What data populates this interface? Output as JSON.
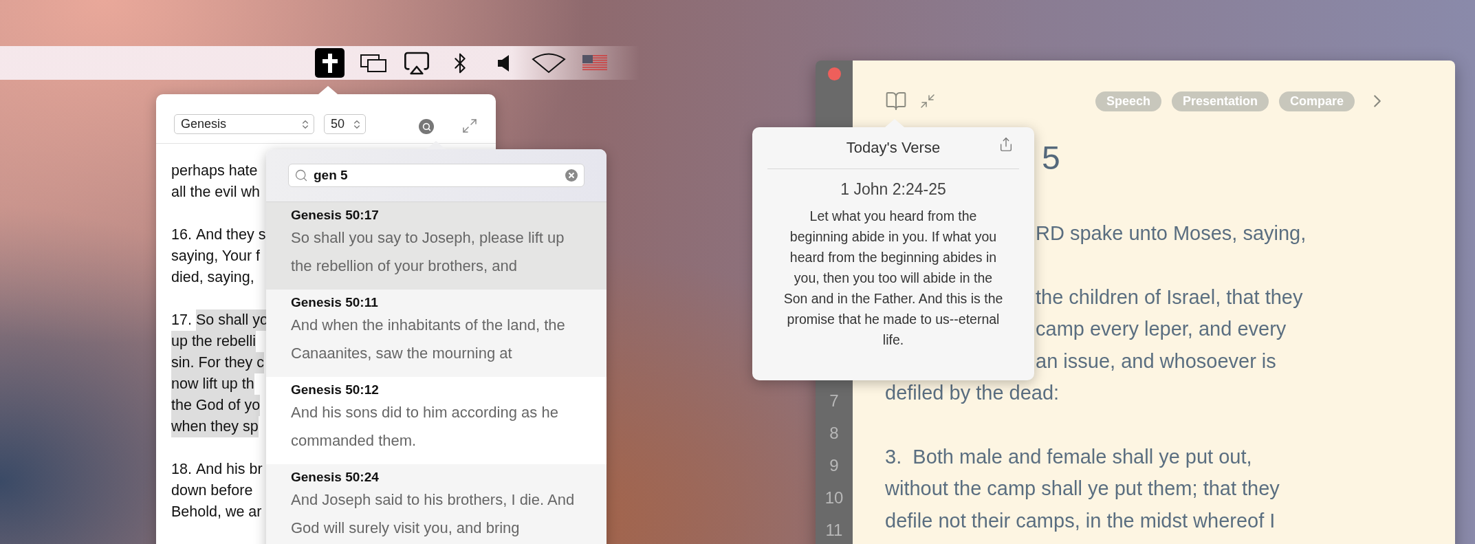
{
  "menu_bar": {
    "items": [
      {
        "kind": "cross",
        "selected": true
      },
      {
        "kind": "displays",
        "selected": false
      },
      {
        "kind": "airplay",
        "selected": false
      },
      {
        "kind": "bluetooth",
        "selected": false
      },
      {
        "kind": "speaker",
        "selected": false
      },
      {
        "kind": "wifi",
        "selected": false
      },
      {
        "kind": "flag",
        "selected": false
      }
    ]
  },
  "reader_popover": {
    "book": "Genesis",
    "chapter": "50",
    "verses": [
      {
        "lines": [
          "perhaps hate",
          "all the evil wh"
        ],
        "selected": false
      },
      {
        "number": "16.",
        "lines": [
          "And they s",
          "saying, Your f",
          "died, saying,"
        ],
        "selected": false
      },
      {
        "number": "17.",
        "lines": [
          "So shall yo",
          "up the rebelli",
          "sin. For they c",
          "now lift up th",
          "the God of yo",
          "when they sp"
        ],
        "selected": true
      },
      {
        "number": "18.",
        "lines": [
          "And his br",
          "down before",
          "Behold, we ar"
        ],
        "selected": false
      }
    ]
  },
  "search_popover": {
    "query": "gen 5",
    "results": [
      {
        "reference": "Genesis 50:17",
        "text": "So shall you say to Joseph, please lift up the rebellion of your brothers, and",
        "selected": true
      },
      {
        "reference": "Genesis 50:11",
        "text": "And when the inhabitants of the land, the Canaanites, saw the mourning at",
        "selected": false
      },
      {
        "reference": "Genesis 50:12",
        "text": "And his sons did to him according as he commanded them.",
        "selected": false
      },
      {
        "reference": "Genesis 50:24",
        "text": "And Joseph said to his brothers, I die. And God will surely visit you, and bring",
        "selected": false
      }
    ]
  },
  "reader_window": {
    "buttons": [
      "Speech",
      "Presentation",
      "Compare"
    ],
    "heading": "5",
    "paragraphs": [
      {
        "lines": [
          {
            "text": "RD spake unto Moses, saying,",
            "kind": "partial"
          }
        ]
      },
      {
        "lines": [
          {
            "text": "the children of Israel, that they",
            "kind": "partial"
          },
          {
            "text": "camp every leper, and every",
            "kind": "partial"
          },
          {
            "text": "an issue, and whosoever is",
            "kind": "partial"
          },
          {
            "text": "defiled by the dead:",
            "kind": "full"
          }
        ]
      },
      {
        "lines": [
          {
            "text": "3.  Both male and female shall ye put out,",
            "kind": "full"
          },
          {
            "text": "without the camp shall ye put them; that they",
            "kind": "full"
          },
          {
            "text": "defile not their camps, in the midst whereof I",
            "kind": "full"
          }
        ]
      }
    ],
    "line_numbers": [
      "7",
      "8",
      "9",
      "10",
      "11"
    ]
  },
  "verse_popover": {
    "title": "Today's Verse",
    "reference": "1 John 2:24-25",
    "text": "Let what you heard from the beginning abide in you. If what you heard from the beginning abides in you, then you too will abide in the Son and in the Father. And this is the promise that he made to us--eternal life."
  }
}
